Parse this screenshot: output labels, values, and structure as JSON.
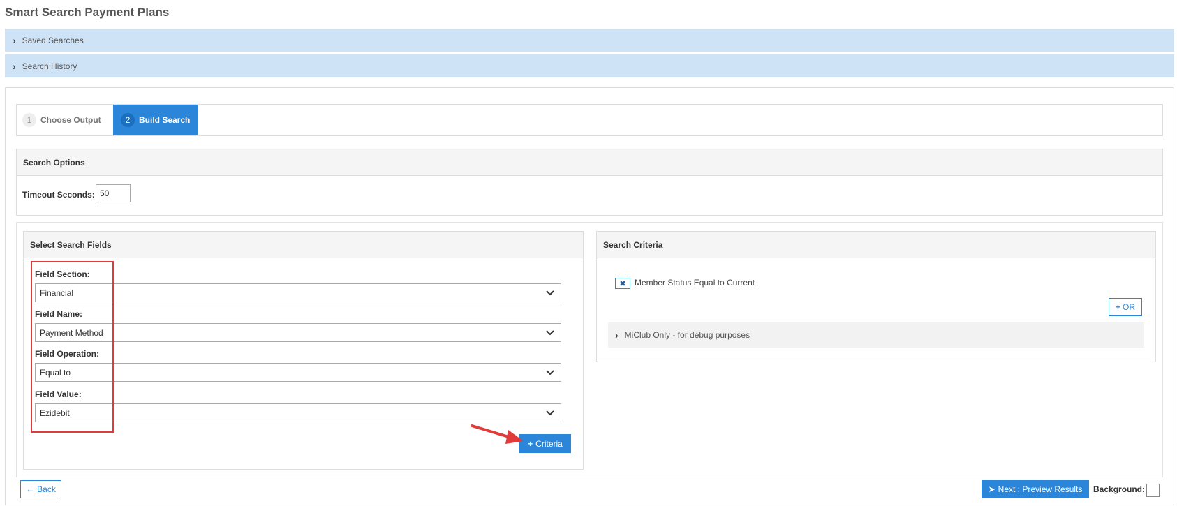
{
  "page": {
    "title": "Smart Search Payment Plans"
  },
  "accordions": [
    {
      "label": "Saved Searches"
    },
    {
      "label": "Search History"
    }
  ],
  "wizard": {
    "steps": [
      {
        "number": "1",
        "label": "Choose Output",
        "active": false
      },
      {
        "number": "2",
        "label": "Build Search",
        "active": true
      }
    ]
  },
  "search_options": {
    "header": "Search Options",
    "timeout_label": "Timeout Seconds:",
    "timeout_value": "50"
  },
  "select_fields": {
    "header": "Select Search Fields",
    "field_section": {
      "label": "Field Section:",
      "value": "Financial"
    },
    "field_name": {
      "label": "Field Name:",
      "value": "Payment Method"
    },
    "field_operation": {
      "label": "Field Operation:",
      "value": "Equal to"
    },
    "field_value": {
      "label": "Field Value:",
      "value": "Ezidebit"
    },
    "add_button": "Criteria"
  },
  "criteria": {
    "header": "Search Criteria",
    "items": [
      {
        "text": "Member Status Equal to Current"
      }
    ],
    "or_button": "OR",
    "debug_label": "MiClub Only - for debug purposes"
  },
  "footer": {
    "back_label": "Back",
    "next_label": "Next : Preview Results",
    "background_label": "Background:"
  },
  "colors": {
    "accent": "#2b86d9",
    "accordion_bg": "#cfe3f7",
    "highlight_red": "#e23b3b"
  }
}
